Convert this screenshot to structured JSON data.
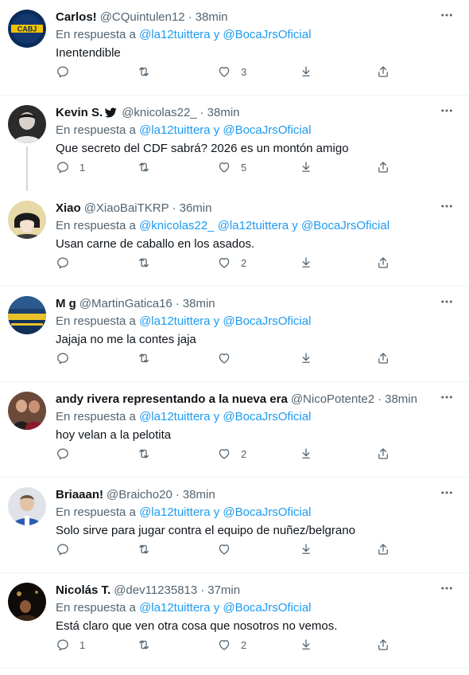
{
  "reply_prefix": "En respuesta a",
  "tweets": [
    {
      "name": "Carlos!",
      "handle": "@CQuintulen12",
      "time": "38min",
      "mentions": "@la12tuittera y @BocaJrsOficial",
      "text": "Inentendible",
      "replies": "",
      "retweets": "",
      "likes": "3",
      "avatar_text": "CABJ"
    },
    {
      "name": "Kevin S.",
      "handle": "@knicolas22_",
      "time": "38min",
      "mentions": "@la12tuittera y @BocaJrsOficial",
      "text": "Que secreto del CDF sabrá? 2026 es un montón amigo",
      "replies": "1",
      "retweets": "",
      "likes": "5"
    },
    {
      "name": "Xiao",
      "handle": "@XiaoBaiTKRP",
      "time": "36min",
      "mentions": "@knicolas22_ @la12tuittera y @BocaJrsOficial",
      "text": "Usan carne de caballo en los asados.",
      "replies": "",
      "retweets": "",
      "likes": "2"
    },
    {
      "name": "M g",
      "handle": "@MartinGatica16",
      "time": "38min",
      "mentions": "@la12tuittera y @BocaJrsOficial",
      "text": "Jajaja no me la contes jaja",
      "replies": "",
      "retweets": "",
      "likes": ""
    },
    {
      "name": "andy rivera representando a la nueva era",
      "handle": "@NicoPotente2",
      "time": "38min",
      "mentions": "@la12tuittera y @BocaJrsOficial",
      "text": "hoy velan a la pelotita",
      "replies": "",
      "retweets": "",
      "likes": "2"
    },
    {
      "name": "Briaaan!",
      "handle": "@Braicho20",
      "time": "38min",
      "mentions": "@la12tuittera y @BocaJrsOficial",
      "text": "Solo sirve para jugar contra el equipo de nuñez/belgrano",
      "replies": "",
      "retweets": "",
      "likes": ""
    },
    {
      "name": "Nicolás T.",
      "handle": "@dev11235813",
      "time": "37min",
      "mentions": "@la12tuittera y @BocaJrsOficial",
      "text": "Está claro que ven otra cosa que nosotros no vemos.",
      "replies": "1",
      "retweets": "",
      "likes": "2"
    }
  ],
  "colors": {
    "link": "#1d9bf0",
    "secondary_text": "#536471",
    "primary_text": "#0f1419",
    "divider": "#eff3f4"
  }
}
